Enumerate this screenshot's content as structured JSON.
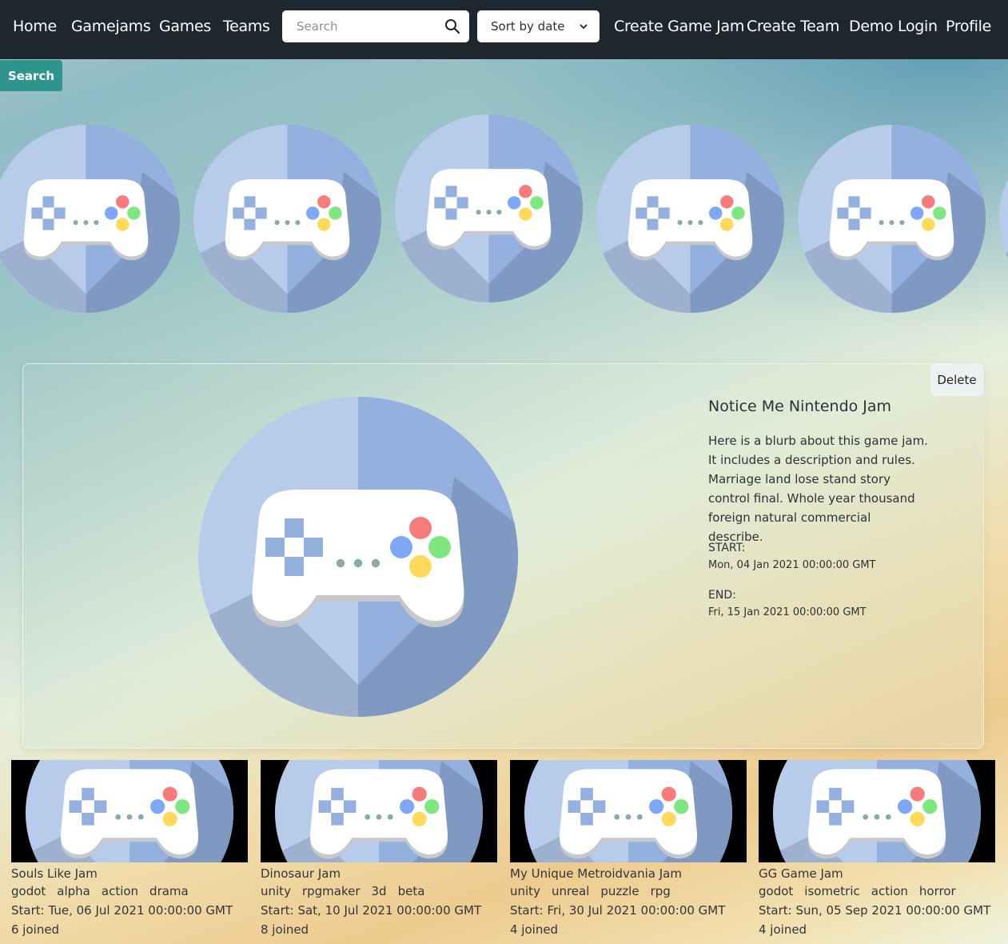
{
  "nav": {
    "home": "Home",
    "gamejams": "Gamejams",
    "games": "Games",
    "teams": "Teams",
    "search_placeholder": "Search",
    "sort_label": "Sort by date",
    "create_game_jam": "Create Game Jam",
    "create_team": "Create Team",
    "demo_login": "Demo Login",
    "profile": "Profile"
  },
  "search_button": "Search",
  "carousel": {
    "item_icon": "gamepad-icon",
    "item_count": 6
  },
  "featured": {
    "title": "Notice Me Nintendo Jam",
    "blurb": "Here is a blurb about this game jam. It includes a description and rules. Marriage land lose stand story control final. Whole year thousand foreign natural commercial describe.",
    "start_label": "START:",
    "start_date": "Mon, 04 Jan 2021 00:00:00 GMT",
    "end_label": "END:",
    "end_date": "Fri, 15 Jan 2021 00:00:00 GMT",
    "delete_label": "Delete"
  },
  "jams": [
    {
      "title": "Souls Like Jam",
      "tags": [
        "godot",
        "alpha",
        "action",
        "drama"
      ],
      "start": "Start: Tue, 06 Jul 2021 00:00:00 GMT",
      "joined": "6 joined"
    },
    {
      "title": "Dinosaur Jam",
      "tags": [
        "unity",
        "rpgmaker",
        "3d",
        "beta"
      ],
      "start": "Start: Sat, 10 Jul 2021 00:00:00 GMT",
      "joined": "8 joined"
    },
    {
      "title": "My Unique Metroidvania Jam",
      "tags": [
        "unity",
        "unreal",
        "puzzle",
        "rpg"
      ],
      "start": "Start: Fri, 30 Jul 2021 00:00:00 GMT",
      "joined": "4 joined"
    },
    {
      "title": "GG Game Jam",
      "tags": [
        "godot",
        "isometric",
        "action",
        "horror"
      ],
      "start": "Start: Sun, 05 Sep 2021 00:00:00 GMT",
      "joined": "4 joined"
    }
  ],
  "colors": {
    "navbar": "#1e262e",
    "search_button": "#2e948e",
    "circle_light": "#b7cbea",
    "circle_dark": "#93b0de"
  }
}
